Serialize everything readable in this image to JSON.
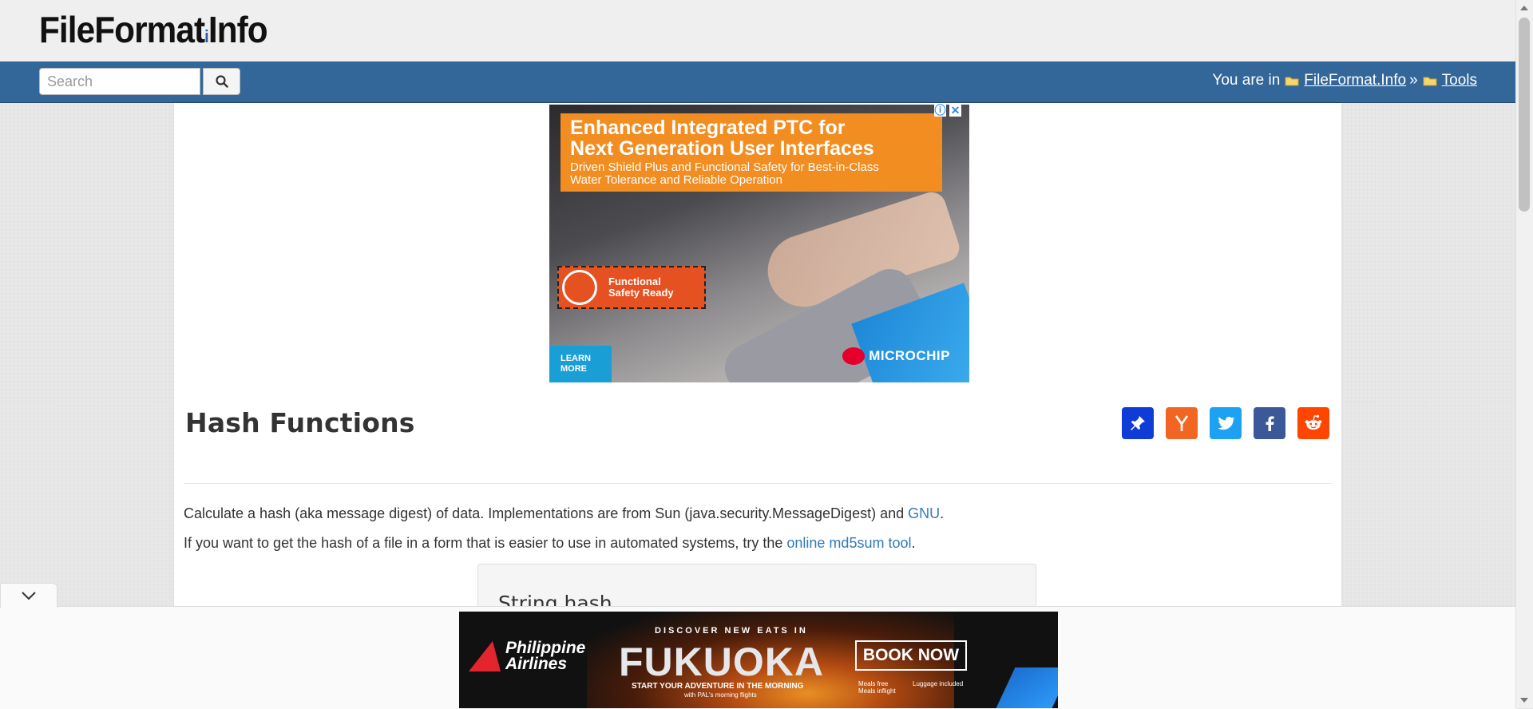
{
  "header": {
    "logo_main": "FileFormat",
    "logo_dot": "i",
    "logo_tail": "Info"
  },
  "navbar": {
    "search_placeholder": "Search",
    "breadcrumb_prefix": "You are in",
    "breadcrumb_items": [
      "FileFormat.Info",
      "Tools"
    ],
    "breadcrumb_separator": "»",
    "background_color": "#336699"
  },
  "ad_top": {
    "headline": "Enhanced Integrated PTC for\nNext Generation User Interfaces",
    "subline": "Driven Shield Plus and Functional Safety for Best-in-Class\nWater Tolerance and Reliable Operation",
    "badge": "Functional\nSafety Ready",
    "cta": "LEARN\nMORE",
    "brand": "MICROCHIP",
    "info_icon": "info-icon",
    "close_icon": "close-icon"
  },
  "main": {
    "title": "Hash Functions",
    "share_buttons": [
      {
        "name": "pinboard-share-button",
        "color": "#0f3bd6"
      },
      {
        "name": "hacker-news-share-button",
        "color": "#f26522"
      },
      {
        "name": "twitter-share-button",
        "color": "#1da1f2"
      },
      {
        "name": "facebook-share-button",
        "color": "#3b5998"
      },
      {
        "name": "reddit-share-button",
        "color": "#ff4500"
      }
    ],
    "para1_text": "Calculate a hash (aka message digest) of data. Implementations are from Sun (java.security.MessageDigest) and ",
    "para1_link": "GNU",
    "para1_end": ".",
    "para2_text": "If you want to get the hash of a file in a form that is easier to use in automated systems, try the ",
    "para2_link": "online md5sum tool",
    "para2_end": ".",
    "panel_title": "String hash",
    "link_color": "#337ab7"
  },
  "ad_bottom": {
    "brand": "Philippine\nAirlines",
    "discover": "DISCOVER NEW EATS IN",
    "city": "FUKUOKA",
    "tagline": "START YOUR ADVENTURE IN THE MORNING",
    "tagline2": "with PAL's morning flights",
    "cta": "BOOK NOW",
    "perk1": "Meals free\nMeals inflight",
    "perk2": "Luggage included"
  }
}
